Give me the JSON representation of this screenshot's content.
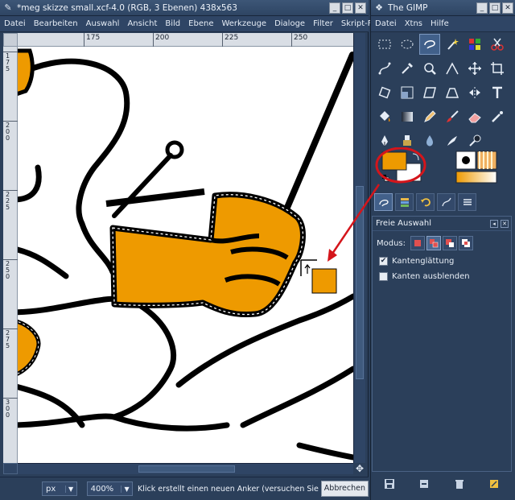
{
  "image_window": {
    "title": "*meg skizze small.xcf-4.0 (RGB, 3 Ebenen) 438x563",
    "menu": [
      "Datei",
      "Bearbeiten",
      "Auswahl",
      "Ansicht",
      "Bild",
      "Ebene",
      "Werkzeuge",
      "Dialoge",
      "Filter",
      "Skript-Fu"
    ],
    "hruler_labels": [
      "175",
      "200",
      "225",
      "250"
    ],
    "vruler_labels": [
      "175",
      "200",
      "225",
      "250",
      "275",
      "300"
    ],
    "unit": "px",
    "zoom": "400%",
    "status_message": "Klick erstellt einen neuen Anker (versuchen Sie die U",
    "cancel_label": "Abbrechen",
    "colors": {
      "fill": "#ee9a00",
      "outline": "#000000",
      "canvas": "#ffffff"
    }
  },
  "toolbox": {
    "title": "The GIMP",
    "menu": [
      "Datei",
      "Xtns",
      "Hilfe"
    ],
    "tools": [
      "rect-select-icon",
      "ellipse-select-icon",
      "free-select-icon",
      "fuzzy-select-icon",
      "select-by-color-icon",
      "scissors-icon",
      "paths-icon",
      "color-picker-icon",
      "zoom-icon",
      "measure-icon",
      "move-icon",
      "crop-icon",
      "rotate-icon",
      "scale-icon",
      "shear-icon",
      "perspective-icon",
      "flip-icon",
      "text-icon",
      "bucket-fill-icon",
      "blend-icon",
      "pencil-icon",
      "paintbrush-icon",
      "eraser-icon",
      "airbrush-icon",
      "ink-icon",
      "clone-icon",
      "blur-icon",
      "smudge-icon",
      "dodge-burn-icon"
    ],
    "foreground_color": "#ee9a00",
    "background_color": "#ffffff",
    "annotation_color": "#d4151b"
  },
  "tool_options": {
    "title": "Freie Auswahl",
    "mode_label": "Modus:",
    "antialias_label": "Kantenglättung",
    "antialias_checked": true,
    "feather_label": "Kanten ausblenden",
    "feather_checked": false
  }
}
